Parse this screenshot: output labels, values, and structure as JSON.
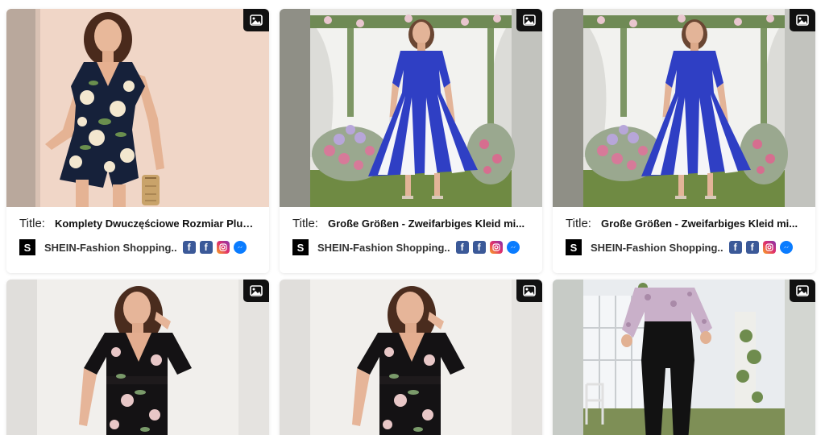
{
  "cards": [
    {
      "title_label": "Title:",
      "title": "Komplety Dwuczęściowe Rozmiar Plus...",
      "store_logo": "S",
      "store_name": "SHEIN-Fashion Shopping..",
      "image_icon": "image-icon",
      "social_icons": [
        "facebook-icon",
        "facebook-icon",
        "instagram-icon",
        "messenger-icon"
      ]
    },
    {
      "title_label": "Title:",
      "title": "Große Größen - Zweifarbiges Kleid mi...",
      "store_logo": "S",
      "store_name": "SHEIN-Fashion Shopping..",
      "image_icon": "image-icon",
      "social_icons": [
        "facebook-icon",
        "facebook-icon",
        "instagram-icon",
        "messenger-icon"
      ]
    },
    {
      "title_label": "Title:",
      "title": "Große Größen - Zweifarbiges Kleid mi...",
      "store_logo": "S",
      "store_name": "SHEIN-Fashion Shopping..",
      "image_icon": "image-icon",
      "social_icons": [
        "facebook-icon",
        "facebook-icon",
        "instagram-icon",
        "messenger-icon"
      ]
    },
    {
      "image_icon": "image-icon"
    },
    {
      "image_icon": "image-icon"
    },
    {
      "image_icon": "image-icon"
    }
  ],
  "colors": {
    "badge": "#111111",
    "facebook": "#3b5998",
    "messenger": "#0a7cff",
    "dress_blue": "#2f3fc4",
    "card_bg": "#ffffff"
  }
}
